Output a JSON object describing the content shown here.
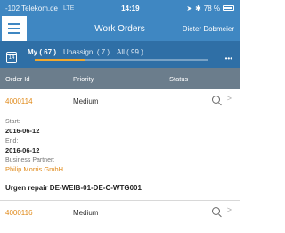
{
  "status_bar": {
    "carrier": "-102 Telekom.de",
    "network": "LTE",
    "time": "14:19",
    "battery": "78 %"
  },
  "header": {
    "title": "Work Orders",
    "user": "Dieter Dobmeier"
  },
  "tabs": [
    {
      "label": "My ( 67 )",
      "active": true
    },
    {
      "label": "Unassign. ( 7 )",
      "active": false
    },
    {
      "label": "All ( 99 )",
      "active": false
    }
  ],
  "columns": {
    "order_id": "Order Id",
    "priority": "Priority",
    "status": "Status"
  },
  "orders": [
    {
      "id": "4000114",
      "priority": "Medium",
      "start_label": "Start:",
      "start": "2016-06-12",
      "end_label": "End:",
      "end": "2016-06-12",
      "partner_label": "Business Partner:",
      "partner": "Philip Morris GmbH",
      "description": "Urgen repair DE-WEIB-01-DE-C-WTG001"
    },
    {
      "id": "4000116",
      "priority": "Medium"
    }
  ],
  "icons": {
    "menu": "hamburger-icon",
    "calendar": "calendar-icon",
    "more": "more-icon",
    "status": "status-icon",
    "chevron": "chevron-right-icon"
  },
  "colors": {
    "header_bg": "#3f87c2",
    "tabs_bg": "#2f6fa6",
    "active_tab_indicator": "#f0a830",
    "column_header_bg": "#6b7d8c",
    "order_id": "#e08a1a"
  }
}
